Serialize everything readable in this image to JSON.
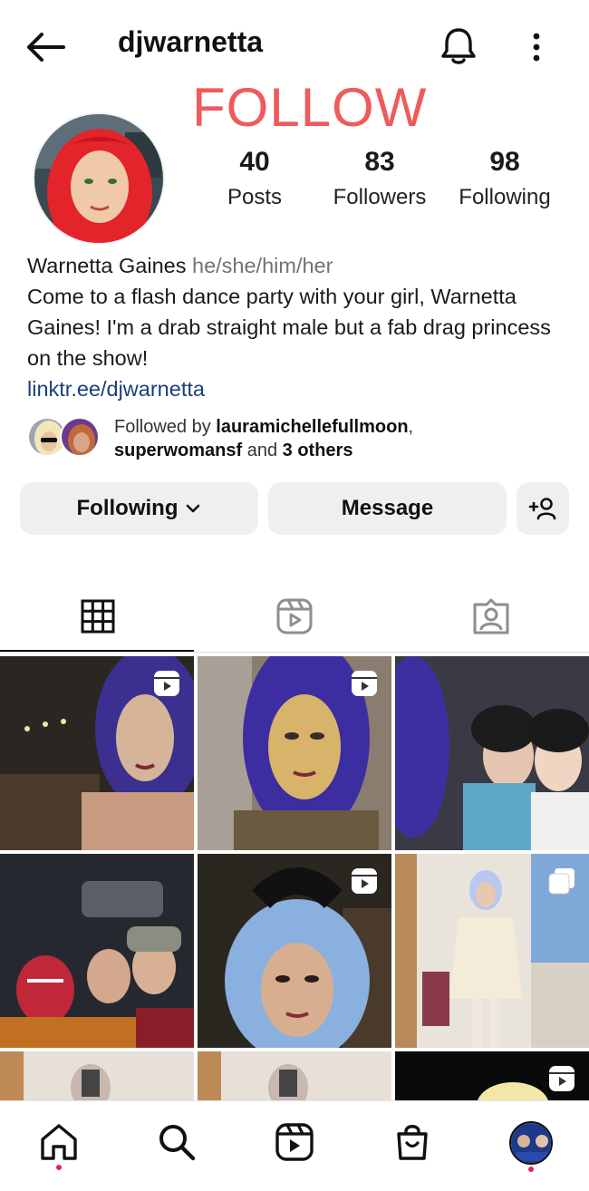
{
  "header": {
    "username": "djwarnetta",
    "overlay_text": "FOLLOW"
  },
  "stats": [
    {
      "value": "40",
      "label": "Posts"
    },
    {
      "value": "83",
      "label": "Followers"
    },
    {
      "value": "98",
      "label": "Following"
    }
  ],
  "bio": {
    "name": "Warnetta Gaines",
    "pronouns": "he/she/him/her",
    "text": "Come to a flash dance party with your girl, Warnetta Gaines! I'm a drab straight male but a fab drag princess on the show!",
    "link": "linktr.ee/djwarnetta"
  },
  "followed_by": {
    "prefix": "Followed by ",
    "user1": "laurami­chellefullmoon",
    "separator": ",",
    "user2": "superwomansf",
    "and": " and ",
    "others": "3 others"
  },
  "actions": {
    "following_label": "Following",
    "message_label": "Message"
  },
  "tabs": [
    "grid-tab",
    "reels-tab",
    "tagged-tab"
  ],
  "colors": {
    "accent": "#ef5a5a",
    "link": "#1b3f7a",
    "button_bg": "#efefef",
    "notification_dot": "#e0245e"
  }
}
